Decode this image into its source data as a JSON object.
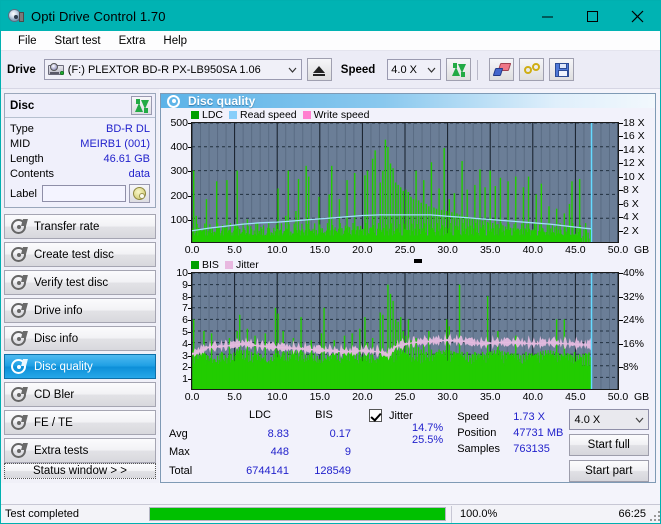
{
  "window": {
    "title": "Opti Drive Control 1.70",
    "icon": "disc-drive-icon",
    "minimize": "minimize-icon",
    "maximize": "maximize-icon",
    "close": "close-icon",
    "accent": "#00b3b3"
  },
  "menu": {
    "items": [
      "File",
      "Start test",
      "Extra",
      "Help"
    ]
  },
  "toolbar": {
    "drive_label": "Drive",
    "drive_value": "(F:)  PLEXTOR BD-R  PX-LB950SA 1.06",
    "eject_label": "eject-icon",
    "speed_label": "Speed",
    "speed_value": "4.0 X",
    "refresh_label": "refresh-icon",
    "eraser_label": "erase-icon",
    "tools_label": "tools-icon",
    "save_label": "save-icon"
  },
  "disc_panel": {
    "title": "Disc",
    "refresh_icon": "refresh-icon",
    "rows": [
      {
        "key": "Type",
        "value": "BD-R DL"
      },
      {
        "key": "MID",
        "value": "MEIRB1 (001)"
      },
      {
        "key": "Length",
        "value": "46.61 GB"
      },
      {
        "key": "Contents",
        "value": "data"
      }
    ],
    "label_key": "Label",
    "label_value": "",
    "label_placeholder": "",
    "label_button_icon": "disc-icon"
  },
  "sidebar": {
    "items": [
      {
        "label": "Transfer rate",
        "active": false
      },
      {
        "label": "Create test disc",
        "active": false
      },
      {
        "label": "Verify test disc",
        "active": false
      },
      {
        "label": "Drive info",
        "active": false
      },
      {
        "label": "Disc info",
        "active": false
      },
      {
        "label": "Disc quality",
        "active": true
      },
      {
        "label": "CD Bler",
        "active": false
      },
      {
        "label": "FE / TE",
        "active": false
      },
      {
        "label": "Extra tests",
        "active": false
      }
    ],
    "status_window": "Status window > >"
  },
  "main": {
    "title": "Disc quality",
    "icon": "disc-quality-icon"
  },
  "chart_data": [
    {
      "type": "line",
      "id": "ldc-chart",
      "title": "",
      "xlabel": "GB",
      "ylabel": "",
      "xlim": [
        0,
        50
      ],
      "ylim": [
        0,
        500
      ],
      "y2lim": [
        0,
        18
      ],
      "grid": true,
      "legend_position": "top-left",
      "legend": [
        {
          "name": "LDC",
          "color": "#00a000"
        },
        {
          "name": "Read speed",
          "color": "#87cefa"
        },
        {
          "name": "Write speed",
          "color": "#ff80d0"
        }
      ],
      "xticks": [
        "0.0",
        "5.0",
        "10.0",
        "15.0",
        "20.0",
        "25.0",
        "30.0",
        "35.0",
        "40.0",
        "45.0",
        "50.0"
      ],
      "xunit": "GB",
      "yticks": [
        "100",
        "200",
        "300",
        "400",
        "500"
      ],
      "y2ticks": [
        "2 X",
        "4 X",
        "6 X",
        "8 X",
        "10 X",
        "12 X",
        "14 X",
        "16 X",
        "18 X"
      ],
      "series": [
        {
          "name": "LDC",
          "color": "#22cc00",
          "kind": "spikes",
          "x": [
            0.2,
            0.5,
            0.8,
            1.1,
            1.4,
            1.7,
            2.0,
            2.3,
            2.6,
            2.9,
            3.2,
            3.5,
            3.8,
            4.1,
            4.4,
            4.7,
            5.0,
            5.3,
            5.6,
            5.9,
            6.2,
            6.5,
            6.8,
            7.1,
            7.4,
            7.7,
            8.0,
            8.3,
            8.6,
            8.9,
            9.2,
            9.5,
            9.8,
            10.1,
            10.4,
            10.7,
            11.0,
            11.3,
            11.6,
            11.9,
            12.2,
            12.5,
            12.8,
            13.1,
            13.4,
            13.7,
            14.0,
            14.3,
            14.6,
            14.9,
            15.2,
            15.5,
            15.8,
            16.1,
            16.4,
            16.7,
            17.0,
            17.3,
            17.6,
            17.9,
            18.2,
            18.5,
            18.8,
            19.1,
            19.4,
            19.7,
            20.0,
            20.3,
            20.6,
            20.9,
            21.2,
            21.5,
            21.8,
            22.1,
            22.4,
            22.7,
            23.0,
            23.3,
            23.6,
            23.9,
            24.2,
            24.5,
            24.8,
            25.1,
            25.4,
            25.7,
            26.0,
            26.3,
            26.6,
            26.9,
            27.2,
            27.5,
            27.8,
            28.1,
            28.4,
            28.7,
            29.0,
            29.3,
            29.6,
            29.9,
            30.2,
            30.5,
            30.8,
            31.1,
            31.4,
            31.7,
            32.0,
            32.3,
            32.6,
            32.9,
            33.2,
            33.5,
            33.8,
            34.1,
            34.4,
            34.7,
            35.0,
            35.3,
            35.6,
            35.9,
            36.2,
            36.5,
            36.8,
            37.1,
            37.4,
            37.7,
            38.0,
            38.3,
            38.6,
            38.9,
            39.2,
            39.5,
            39.8,
            40.1,
            40.4,
            40.7,
            41.0,
            41.3,
            41.6,
            41.9,
            42.2,
            42.5,
            42.8,
            43.1,
            43.4,
            43.7,
            44.0,
            44.3,
            44.6,
            44.9,
            45.2,
            45.5,
            45.8,
            46.1,
            46.4,
            46.7
          ],
          "values": [
            300,
            110,
            60,
            45,
            55,
            180,
            40,
            38,
            42,
            255,
            60,
            48,
            60,
            260,
            52,
            40,
            70,
            300,
            55,
            42,
            50,
            95,
            35,
            30,
            34,
            80,
            30,
            28,
            30,
            60,
            28,
            30,
            45,
            225,
            52,
            36,
            110,
            300,
            44,
            36,
            130,
            265,
            48,
            40,
            320,
            275,
            46,
            38,
            50,
            190,
            40,
            36,
            48,
            200,
            320,
            52,
            44,
            180,
            58,
            48,
            260,
            62,
            50,
            290,
            66,
            52,
            54,
            280,
            300,
            58,
            350,
            385,
            56,
            250,
            300,
            430,
            400,
            330,
            310,
            250,
            240,
            230,
            215,
            220,
            210,
            190,
            180,
            300,
            175,
            165,
            260,
            160,
            150,
            335,
            145,
            140,
            225,
            135,
            395,
            130,
            180,
            125,
            205,
            120,
            115,
            340,
            110,
            220,
            105,
            100,
            240,
            95,
            305,
            90,
            230,
            85,
            300,
            80,
            235,
            75,
            270,
            70,
            65,
            255,
            60,
            58,
            275,
            56,
            54,
            230,
            52,
            275,
            50,
            48,
            200,
            46,
            245,
            44,
            42,
            150,
            40,
            38,
            140,
            36,
            34,
            120,
            32,
            160,
            255,
            30,
            28,
            265
          ]
        },
        {
          "name": "Read speed",
          "color": "#9fe0f7",
          "kind": "line",
          "x": [
            0,
            2,
            4,
            6,
            8,
            10,
            12,
            14,
            16,
            18,
            20,
            22,
            24,
            26,
            28,
            30,
            32,
            34,
            36,
            38,
            40,
            42,
            44,
            46,
            46.9
          ],
          "values": [
            1.7,
            2.1,
            2.4,
            2.7,
            2.9,
            3.0,
            3.2,
            3.4,
            3.6,
            3.8,
            4.0,
            4.1,
            4.1,
            4.1,
            4.1,
            3.9,
            3.7,
            3.5,
            3.3,
            3.1,
            2.9,
            2.7,
            2.4,
            2.1,
            2.0
          ]
        }
      ],
      "cursor_x": 46.9
    },
    {
      "type": "line",
      "id": "bis-chart",
      "title": "",
      "xlabel": "GB",
      "ylabel": "",
      "xlim": [
        0,
        50
      ],
      "ylim": [
        0,
        10
      ],
      "y2lim": [
        0,
        40
      ],
      "grid": true,
      "legend_position": "top-left",
      "legend": [
        {
          "name": "BIS",
          "color": "#00a000"
        },
        {
          "name": "Jitter",
          "color": "#e8b8e0"
        }
      ],
      "xticks": [
        "0.0",
        "5.0",
        "10.0",
        "15.0",
        "20.0",
        "25.0",
        "30.0",
        "35.0",
        "40.0",
        "45.0",
        "50.0"
      ],
      "xunit": "GB",
      "yticks": [
        "1",
        "2",
        "3",
        "4",
        "5",
        "6",
        "7",
        "8",
        "9",
        "10"
      ],
      "y2ticks": [
        "8%",
        "16%",
        "24%",
        "32%",
        "40%"
      ],
      "series": [
        {
          "name": "BIS",
          "color": "#22cc00",
          "kind": "spikes",
          "baseline": 2.0,
          "x": [
            0.2,
            0.5,
            0.8,
            1.1,
            1.4,
            1.7,
            2.0,
            2.3,
            2.6,
            2.9,
            3.2,
            3.5,
            3.8,
            4.1,
            4.4,
            4.7,
            5.0,
            5.3,
            5.6,
            5.9,
            6.2,
            6.5,
            6.8,
            7.1,
            7.4,
            7.7,
            8.0,
            8.3,
            8.6,
            8.9,
            9.2,
            9.5,
            9.8,
            10.1,
            10.4,
            10.7,
            11.0,
            11.3,
            11.6,
            11.9,
            12.2,
            12.5,
            12.8,
            13.1,
            13.4,
            13.7,
            14.0,
            14.3,
            14.6,
            14.9,
            15.2,
            15.5,
            15.8,
            16.1,
            16.4,
            16.7,
            17.0,
            17.3,
            17.6,
            17.9,
            18.2,
            18.5,
            18.8,
            19.1,
            19.4,
            19.7,
            20.0,
            20.3,
            20.6,
            20.9,
            21.2,
            21.5,
            21.8,
            22.1,
            22.4,
            22.7,
            23.0,
            23.3,
            23.6,
            23.9,
            24.2,
            24.5,
            24.8,
            25.1,
            25.4,
            25.7,
            26.0,
            26.3,
            26.6,
            26.9,
            27.2,
            27.5,
            27.8,
            28.1,
            28.4,
            28.7,
            29.0,
            29.3,
            29.6,
            29.9,
            30.2,
            30.5,
            30.8,
            31.1,
            31.4,
            31.7,
            32.0,
            32.3,
            32.6,
            32.9,
            33.2,
            33.5,
            33.8,
            34.1,
            34.4,
            34.7,
            35.0,
            35.3,
            35.6,
            35.9,
            36.2,
            36.5,
            36.8,
            37.1,
            37.4,
            37.7,
            38.0,
            38.3,
            38.6,
            38.9,
            39.2,
            39.5,
            39.8,
            40.1,
            40.4,
            40.7,
            41.0,
            41.3,
            41.6,
            41.9,
            42.2,
            42.5,
            42.8,
            43.1,
            43.4,
            43.7,
            44.0,
            44.3,
            44.6,
            44.9,
            45.2,
            45.5,
            45.8,
            46.1,
            46.4,
            46.7
          ],
          "values": [
            6.0,
            3.0,
            2.6,
            2.8,
            5.0,
            2.5,
            2.4,
            4.8,
            2.6,
            2.3,
            2.5,
            3.2,
            2.4,
            2.2,
            4.4,
            2.5,
            2.4,
            5.0,
            6.4,
            2.6,
            2.5,
            5.2,
            2.4,
            2.3,
            4.6,
            2.5,
            2.4,
            2.6,
            4.8,
            2.3,
            2.5,
            2.4,
            7.0,
            6.5,
            2.6,
            5.0,
            2.5,
            2.4,
            2.6,
            4.4,
            2.5,
            2.4,
            6.2,
            2.6,
            2.4,
            2.5,
            4.2,
            2.4,
            2.3,
            2.6,
            4.8,
            7.0,
            2.5,
            2.4,
            2.6,
            4.2,
            2.5,
            2.4,
            2.6,
            4.6,
            2.5,
            2.4,
            4.8,
            2.6,
            2.5,
            5.2,
            2.4,
            6.2,
            4.0,
            2.6,
            4.4,
            2.5,
            2.6,
            6.6,
            6.4,
            3.2,
            9.0,
            8.2,
            7.6,
            6.0,
            5.8,
            6.2,
            5.0,
            4.6,
            6.0,
            4.2,
            3.8,
            4.4,
            3.6,
            3.4,
            3.8,
            3.2,
            5.0,
            3.4,
            3.0,
            3.2,
            3.4,
            3.0,
            3.2,
            6.0,
            5.4,
            3.0,
            3.2,
            3.0,
            9.0,
            3.2,
            3.0,
            3.2,
            2.9,
            3.0,
            3.2,
            2.9,
            3.0,
            3.2,
            2.9,
            8.0,
            3.2,
            2.9,
            3.0,
            5.0,
            3.2,
            2.9,
            3.0,
            3.2,
            2.9,
            3.0,
            4.6,
            3.0,
            2.9,
            3.0,
            3.2,
            2.9,
            3.0,
            2.9,
            3.0,
            2.9,
            3.0,
            2.9,
            3.0,
            2.9,
            3.0,
            2.9,
            6.0,
            2.9,
            3.0,
            6.0,
            2.9,
            3.0,
            2.9,
            3.2,
            2.9,
            3.0
          ]
        },
        {
          "name": "Jitter",
          "color": "#e4bbdf",
          "kind": "line",
          "x": [
            0,
            2,
            4,
            6,
            8,
            10,
            12,
            14,
            16,
            18,
            20,
            22,
            23,
            24,
            26,
            28,
            30,
            32,
            34,
            36,
            38,
            40,
            42,
            44,
            46,
            46.9
          ],
          "values": [
            3.0,
            3.6,
            3.7,
            3.9,
            3.7,
            3.6,
            3.5,
            3.4,
            3.3,
            3.2,
            3.3,
            3.2,
            2.9,
            3.7,
            4.0,
            4.1,
            4.2,
            4.1,
            3.9,
            4.0,
            4.0,
            3.9,
            4.0,
            3.9,
            3.8,
            3.8
          ]
        }
      ],
      "cursor_x": 46.9,
      "cursor_color": "#66d9ff"
    }
  ],
  "stats": {
    "columns": [
      "LDC",
      "BIS"
    ],
    "rows": [
      {
        "label": "Avg",
        "ldc": "8.83",
        "bis": "0.17"
      },
      {
        "label": "Max",
        "ldc": "448",
        "bis": "9"
      },
      {
        "label": "Total",
        "ldc": "6744141",
        "bis": "128549"
      }
    ],
    "jitter": {
      "checked": true,
      "label": "Jitter",
      "avg": "14.7%",
      "max": "25.5%"
    },
    "speed_label": "Speed",
    "speed_value": "1.73 X",
    "position_label": "Position",
    "position_value": "47731 MB",
    "samples_label": "Samples",
    "samples_value": "763135",
    "speed_select": "4.0 X",
    "start_full": "Start full",
    "start_part": "Start part"
  },
  "statusbar": {
    "text": "Test completed",
    "progress_percent": 100.0,
    "percent_label": "100.0%",
    "time": "66:25",
    "progress_color": "#00c000"
  }
}
